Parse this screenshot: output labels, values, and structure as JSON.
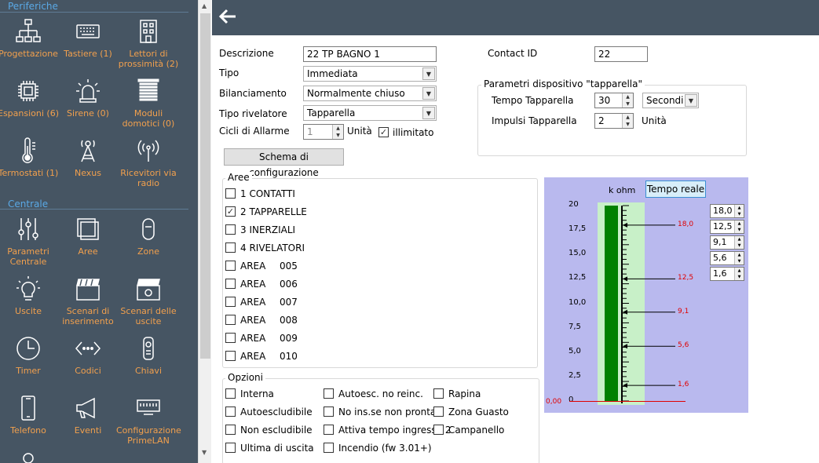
{
  "sidebar": {
    "periferiche_title": "Periferiche",
    "centrale_title": "Centrale",
    "items": [
      {
        "label": "Progettazione"
      },
      {
        "label": "Tastiere (1)"
      },
      {
        "label": "Lettori di prossimità (2)"
      },
      {
        "label": "Espansioni (6)"
      },
      {
        "label": "Sirene (0)"
      },
      {
        "label": "Moduli domotici (0)"
      },
      {
        "label": "Termostati (1)"
      },
      {
        "label": "Nexus"
      },
      {
        "label": "Ricevitori via radio"
      },
      {
        "label": "Parametri Centrale"
      },
      {
        "label": "Aree"
      },
      {
        "label": "Zone"
      },
      {
        "label": "Uscite"
      },
      {
        "label": "Scenari di inserimento"
      },
      {
        "label": "Scenari delle uscite"
      },
      {
        "label": "Timer"
      },
      {
        "label": "Codici"
      },
      {
        "label": "Chiavi"
      },
      {
        "label": "Telefono"
      },
      {
        "label": "Eventi"
      },
      {
        "label": "Configurazione PrimeLAN"
      }
    ]
  },
  "form": {
    "descrizione_label": "Descrizione",
    "descrizione_value": "22 TP BAGNO 1",
    "contact_id_label": "Contact ID",
    "contact_id_value": "22",
    "tipo_label": "Tipo",
    "tipo_value": "Immediata",
    "bilanciamento_label": "Bilanciamento",
    "bilanciamento_value": "Normalmente chiuso",
    "tipo_rivelatore_label": "Tipo rivelatore",
    "tipo_rivelatore_value": "Tapparella",
    "cicli_label": "Cicli di Allarme",
    "cicli_value": "1",
    "cicli_unit": "Unità",
    "illimitato_label": "illimitato",
    "schema_button": "Schema di configurazione"
  },
  "tapparella": {
    "title": "Parametri dispositivo \"tapparella\"",
    "tempo_label": "Tempo Tapparella",
    "tempo_value": "30",
    "tempo_unit": "Secondi",
    "impulsi_label": "Impulsi Tapparella",
    "impulsi_value": "2",
    "impulsi_unit": "Unità"
  },
  "aree": {
    "title": "Aree",
    "items": [
      {
        "label": "1 CONTATTI",
        "num": "",
        "checked": false
      },
      {
        "label": "2 TAPPARELLE",
        "num": "",
        "checked": true
      },
      {
        "label": "3 INERZIALI",
        "num": "",
        "checked": false
      },
      {
        "label": "4 RIVELATORI",
        "num": "",
        "checked": false
      },
      {
        "label": "AREA",
        "num": "005",
        "checked": false
      },
      {
        "label": "AREA",
        "num": "006",
        "checked": false
      },
      {
        "label": "AREA",
        "num": "007",
        "checked": false
      },
      {
        "label": "AREA",
        "num": "008",
        "checked": false
      },
      {
        "label": "AREA",
        "num": "009",
        "checked": false
      },
      {
        "label": "AREA",
        "num": "010",
        "checked": false
      }
    ]
  },
  "opzioni": {
    "title": "Opzioni",
    "items": [
      {
        "label": "Interna"
      },
      {
        "label": "Autoesc. no reinc."
      },
      {
        "label": "Rapina"
      },
      {
        "label": "Autoescludibile"
      },
      {
        "label": "No ins.se non pronta"
      },
      {
        "label": "Zona Guasto"
      },
      {
        "label": "Non escludibile"
      },
      {
        "label": "Attiva tempo ingresso 2"
      },
      {
        "label": "Campanello"
      },
      {
        "label": "Ultima di uscita"
      },
      {
        "label": "Incendio (fw 3.01+)"
      }
    ]
  },
  "chart_data": {
    "type": "bar",
    "title": "k ohm",
    "button_label": "Tempo reale",
    "ylim": [
      0,
      20
    ],
    "ticks": [
      "20",
      "17,5",
      "15,0",
      "12,5",
      "10,0",
      "7,5",
      "5,0",
      "2,5",
      "0"
    ],
    "tick_values": [
      20,
      17.5,
      15,
      12.5,
      10,
      7.5,
      5,
      2.5,
      0
    ],
    "values": [
      20
    ],
    "thresholds": [
      "18,0",
      "12,5",
      "9,1",
      "5,6",
      "1,6"
    ],
    "threshold_values": [
      18.0,
      12.5,
      9.1,
      5.6,
      1.6
    ],
    "baseline_label": "0,00",
    "bar_color": "#008000",
    "threshold_color": "#e00000"
  }
}
